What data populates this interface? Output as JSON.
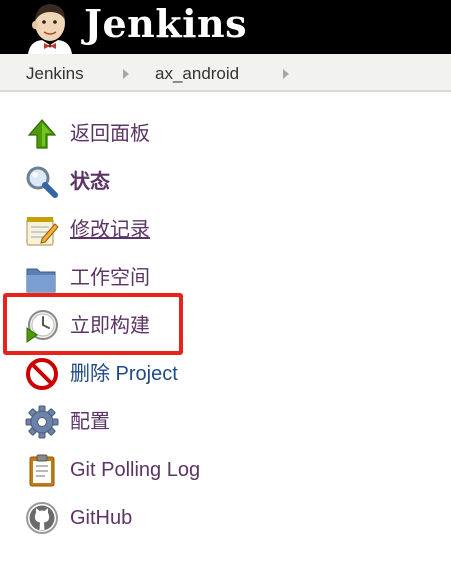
{
  "header": {
    "logo_text": "Jenkins"
  },
  "breadcrumb": {
    "items": [
      "Jenkins",
      "ax_android"
    ]
  },
  "tasks": [
    {
      "label": "返回面板",
      "icon": "up-arrow-icon"
    },
    {
      "label": "状态",
      "icon": "magnifier-icon"
    },
    {
      "label": "修改记录",
      "icon": "notepad-icon"
    },
    {
      "label": "工作空间",
      "icon": "folder-icon"
    },
    {
      "label": "立即构建",
      "icon": "build-clock-icon"
    },
    {
      "label": "删除 Project",
      "icon": "no-entry-icon"
    },
    {
      "label": "配置",
      "icon": "gear-icon"
    },
    {
      "label": "Git Polling Log",
      "icon": "clipboard-icon"
    },
    {
      "label": "GitHub",
      "icon": "github-icon"
    }
  ],
  "colors": {
    "header_bg": "#000000",
    "breadcrumb_bg": "#f2f3ee",
    "link_purple": "#5c3566",
    "link_blue": "#204a87",
    "highlight_red": "#e8231c"
  }
}
